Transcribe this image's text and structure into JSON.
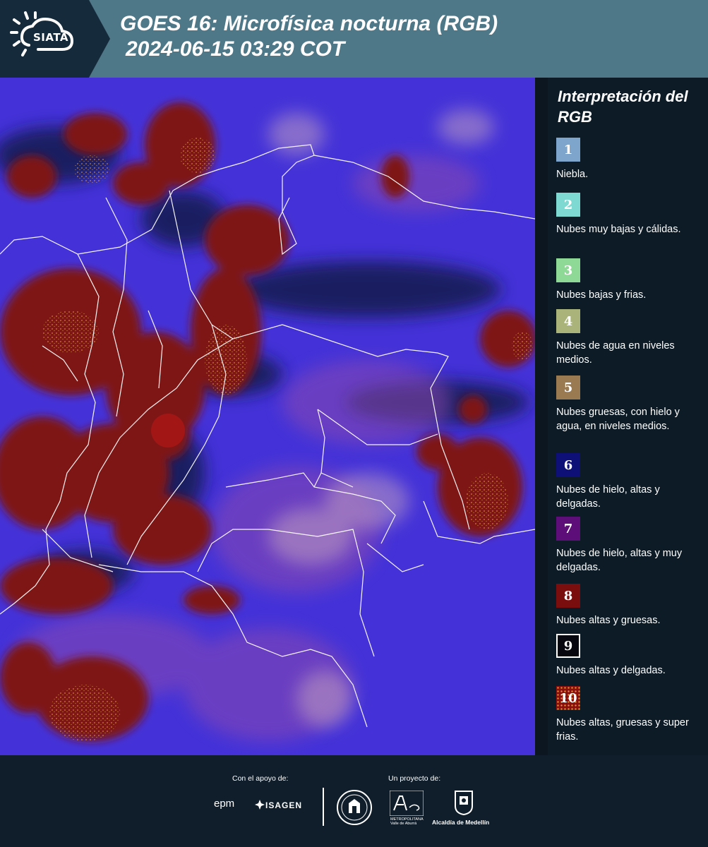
{
  "header": {
    "logo_text": "SIATA",
    "title_line1": "GOES 16: Microfísica nocturna (RGB)",
    "title_line2": "2024-06-15 03:29 COT"
  },
  "legend": {
    "title": "Interpretación del RGB",
    "items": [
      {
        "number": "1",
        "label": "Niebla.",
        "color": "#7ea5cb"
      },
      {
        "number": "2",
        "label": "Nubes muy bajas y cálidas.",
        "color": "#7dd9d2"
      },
      {
        "number": "3",
        "label": "Nubes bajas y frias.",
        "color": "#8fd996"
      },
      {
        "number": "4",
        "label": "Nubes de agua en niveles medios.",
        "color": "#aab47a"
      },
      {
        "number": "5",
        "label": "Nubes gruesas, con hielo y agua, en niveles medios.",
        "color": "#9a7a50"
      },
      {
        "number": "6",
        "label": "Nubes de hielo, altas y delgadas.",
        "color": "#0f0f78"
      },
      {
        "number": "7",
        "label": "Nubes de hielo, altas y muy delgadas.",
        "color": "#5e0e78"
      },
      {
        "number": "8",
        "label": "Nubes altas y gruesas.",
        "color": "#7a0d0d"
      },
      {
        "number": "9",
        "label": "Nubes altas y delgadas.",
        "color": "#07070f"
      },
      {
        "number": "10",
        "label": "Nubes altas, gruesas y super frias.",
        "color": "#8a1010"
      }
    ]
  },
  "footer": {
    "support_label": "Con el apoyo de:",
    "project_label": "Un proyecto de:",
    "epm": "epm",
    "isagen": "ISAGEN",
    "area_text": "Área",
    "metro_text": "METROPOLITANA Valle de Aburrá",
    "alcaldia": "Alcaldía de Medellín"
  }
}
